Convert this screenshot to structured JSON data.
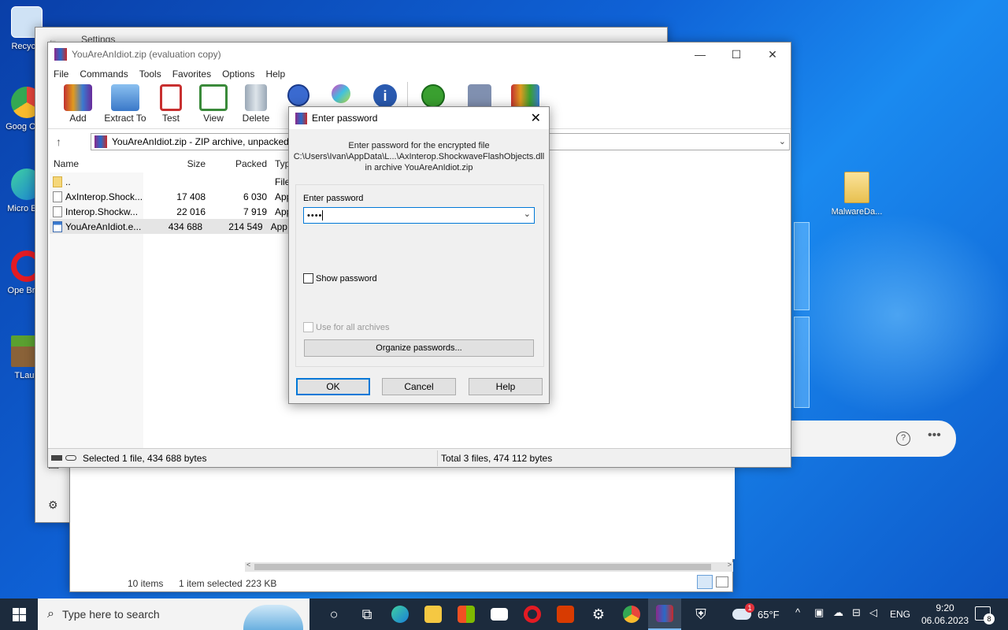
{
  "desktop": {
    "icons": [
      {
        "label": "Recycle",
        "color": "#bcd6f0"
      },
      {
        "label": "Goog Chro",
        "color": "#e8453c"
      },
      {
        "label": "Micro Edg",
        "color": "#1a9be0"
      },
      {
        "label": "Ope Brow",
        "color": "#e31b23"
      },
      {
        "label": "TLaun",
        "color": "#4a8a2a"
      }
    ],
    "right_icon_label": "MalwareDa..."
  },
  "settings_window": {
    "title": "Settings"
  },
  "explorer_status": {
    "items": "10 items",
    "selected": "1 item selected",
    "size": "223 KB"
  },
  "winrar": {
    "title": "YouAreAnIdiot.zip (evaluation copy)",
    "menu": [
      "File",
      "Commands",
      "Tools",
      "Favorites",
      "Options",
      "Help"
    ],
    "toolbar": [
      {
        "label": "Add",
        "color": "#c23030"
      },
      {
        "label": "Extract To",
        "color": "#4a88d0"
      },
      {
        "label": "Test",
        "color": "#d04040"
      },
      {
        "label": "View",
        "color": "#3a8a3a"
      },
      {
        "label": "Delete",
        "color": "#8a9aaa"
      }
    ],
    "address": "YouAreAnIdiot.zip - ZIP archive, unpacked s",
    "columns": {
      "name": "Name",
      "size": "Size",
      "packed": "Packed",
      "type": "Typ"
    },
    "files": [
      {
        "name": "..",
        "size": "",
        "packed": "",
        "type": "File"
      },
      {
        "name": "AxInterop.Shock...",
        "size": "17 408",
        "packed": "6 030",
        "type": "App"
      },
      {
        "name": "Interop.Shockw...",
        "size": "22 016",
        "packed": "7 919",
        "type": "App"
      },
      {
        "name": "YouAreAnIdiot.e...",
        "size": "434 688",
        "packed": "214 549",
        "type": "App"
      }
    ],
    "status_left": "Selected 1 file, 434 688 bytes",
    "status_right": "Total 3 files, 474 112 bytes"
  },
  "dialog": {
    "title": "Enter password",
    "info_line1": "Enter password for the encrypted file",
    "info_line2": "C:\\Users\\Ivan\\AppData\\L...\\AxInterop.ShockwaveFlashObjects.dll",
    "info_line3": "in archive YouAreAnIdiot.zip",
    "password_label": "Enter password",
    "password_value": "••••",
    "show_password": "Show password",
    "use_for_all": "Use for all archives",
    "organize": "Organize passwords...",
    "ok": "OK",
    "cancel": "Cancel",
    "help": "Help"
  },
  "taskbar": {
    "search_placeholder": "Type here to search",
    "weather": "65°F",
    "weather_badge": "1",
    "language": "ENG",
    "time": "9:20",
    "date": "06.06.2023",
    "notification_count": "8"
  }
}
